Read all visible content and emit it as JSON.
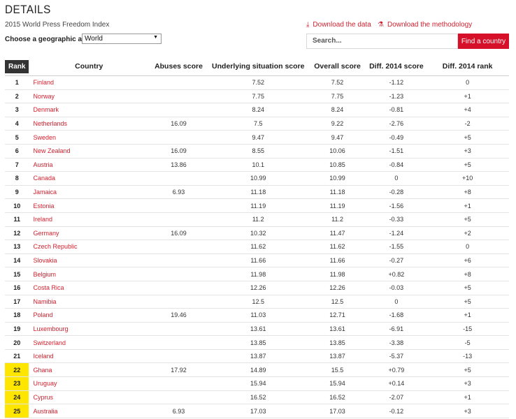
{
  "header": {
    "title": "DETAILS",
    "subtitle": "2015 World Press Freedom Index",
    "geo_label": "Choose a geographic area:",
    "geo_value": "World",
    "download_data": "Download the data",
    "download_method": "Download the methodology",
    "search_placeholder": "Search...",
    "find_button": "Find a country"
  },
  "colors": {
    "accent": "#d7102a",
    "highlight": "#ffe600",
    "rank_header_bg": "#333333"
  },
  "table": {
    "columns": [
      "Rank",
      "Country",
      "Abuses score",
      "Underlying situation score",
      "Overall score",
      "Diff. 2014 score",
      "Diff. 2014 rank"
    ],
    "rows": [
      {
        "rank": "1",
        "country": "Finland",
        "abuses": "",
        "underlying": "7.52",
        "overall": "7.52",
        "diff_score": "-1.12",
        "diff_rank": "0",
        "hl": false
      },
      {
        "rank": "2",
        "country": "Norway",
        "abuses": "",
        "underlying": "7.75",
        "overall": "7.75",
        "diff_score": "-1.23",
        "diff_rank": "+1",
        "hl": false
      },
      {
        "rank": "3",
        "country": "Denmark",
        "abuses": "",
        "underlying": "8.24",
        "overall": "8.24",
        "diff_score": "-0.81",
        "diff_rank": "+4",
        "hl": false
      },
      {
        "rank": "4",
        "country": "Netherlands",
        "abuses": "16.09",
        "underlying": "7.5",
        "overall": "9.22",
        "diff_score": "-2.76",
        "diff_rank": "-2",
        "hl": false
      },
      {
        "rank": "5",
        "country": "Sweden",
        "abuses": "",
        "underlying": "9.47",
        "overall": "9.47",
        "diff_score": "-0.49",
        "diff_rank": "+5",
        "hl": false
      },
      {
        "rank": "6",
        "country": "New Zealand",
        "abuses": "16.09",
        "underlying": "8.55",
        "overall": "10.06",
        "diff_score": "-1.51",
        "diff_rank": "+3",
        "hl": false
      },
      {
        "rank": "7",
        "country": "Austria",
        "abuses": "13.86",
        "underlying": "10.1",
        "overall": "10.85",
        "diff_score": "-0.84",
        "diff_rank": "+5",
        "hl": false
      },
      {
        "rank": "8",
        "country": "Canada",
        "abuses": "",
        "underlying": "10.99",
        "overall": "10.99",
        "diff_score": "0",
        "diff_rank": "+10",
        "hl": false
      },
      {
        "rank": "9",
        "country": "Jamaica",
        "abuses": "6.93",
        "underlying": "11.18",
        "overall": "11.18",
        "diff_score": "-0.28",
        "diff_rank": "+8",
        "hl": false
      },
      {
        "rank": "10",
        "country": "Estonia",
        "abuses": "",
        "underlying": "11.19",
        "overall": "11.19",
        "diff_score": "-1.56",
        "diff_rank": "+1",
        "hl": false
      },
      {
        "rank": "11",
        "country": "Ireland",
        "abuses": "",
        "underlying": "11.2",
        "overall": "11.2",
        "diff_score": "-0.33",
        "diff_rank": "+5",
        "hl": false
      },
      {
        "rank": "12",
        "country": "Germany",
        "abuses": "16.09",
        "underlying": "10.32",
        "overall": "11.47",
        "diff_score": "-1.24",
        "diff_rank": "+2",
        "hl": false
      },
      {
        "rank": "13",
        "country": "Czech Republic",
        "abuses": "",
        "underlying": "11.62",
        "overall": "11.62",
        "diff_score": "-1.55",
        "diff_rank": "0",
        "hl": false
      },
      {
        "rank": "14",
        "country": "Slovakia",
        "abuses": "",
        "underlying": "11.66",
        "overall": "11.66",
        "diff_score": "-0.27",
        "diff_rank": "+6",
        "hl": false
      },
      {
        "rank": "15",
        "country": "Belgium",
        "abuses": "",
        "underlying": "11.98",
        "overall": "11.98",
        "diff_score": "+0.82",
        "diff_rank": "+8",
        "hl": false
      },
      {
        "rank": "16",
        "country": "Costa Rica",
        "abuses": "",
        "underlying": "12.26",
        "overall": "12.26",
        "diff_score": "-0.03",
        "diff_rank": "+5",
        "hl": false
      },
      {
        "rank": "17",
        "country": "Namibia",
        "abuses": "",
        "underlying": "12.5",
        "overall": "12.5",
        "diff_score": "0",
        "diff_rank": "+5",
        "hl": false
      },
      {
        "rank": "18",
        "country": "Poland",
        "abuses": "19.46",
        "underlying": "11.03",
        "overall": "12.71",
        "diff_score": "-1.68",
        "diff_rank": "+1",
        "hl": false
      },
      {
        "rank": "19",
        "country": "Luxembourg",
        "abuses": "",
        "underlying": "13.61",
        "overall": "13.61",
        "diff_score": "-6.91",
        "diff_rank": "-15",
        "hl": false
      },
      {
        "rank": "20",
        "country": "Switzerland",
        "abuses": "",
        "underlying": "13.85",
        "overall": "13.85",
        "diff_score": "-3.38",
        "diff_rank": "-5",
        "hl": false
      },
      {
        "rank": "21",
        "country": "Iceland",
        "abuses": "",
        "underlying": "13.87",
        "overall": "13.87",
        "diff_score": "-5.37",
        "diff_rank": "-13",
        "hl": false
      },
      {
        "rank": "22",
        "country": "Ghana",
        "abuses": "17.92",
        "underlying": "14.89",
        "overall": "15.5",
        "diff_score": "+0.79",
        "diff_rank": "+5",
        "hl": true
      },
      {
        "rank": "23",
        "country": "Uruguay",
        "abuses": "",
        "underlying": "15.94",
        "overall": "15.94",
        "diff_score": "+0.14",
        "diff_rank": "+3",
        "hl": true
      },
      {
        "rank": "24",
        "country": "Cyprus",
        "abuses": "",
        "underlying": "16.52",
        "overall": "16.52",
        "diff_score": "-2.07",
        "diff_rank": "+1",
        "hl": true
      },
      {
        "rank": "25",
        "country": "Australia",
        "abuses": "6.93",
        "underlying": "17.03",
        "overall": "17.03",
        "diff_score": "-0.12",
        "diff_rank": "+3",
        "hl": true
      }
    ]
  }
}
